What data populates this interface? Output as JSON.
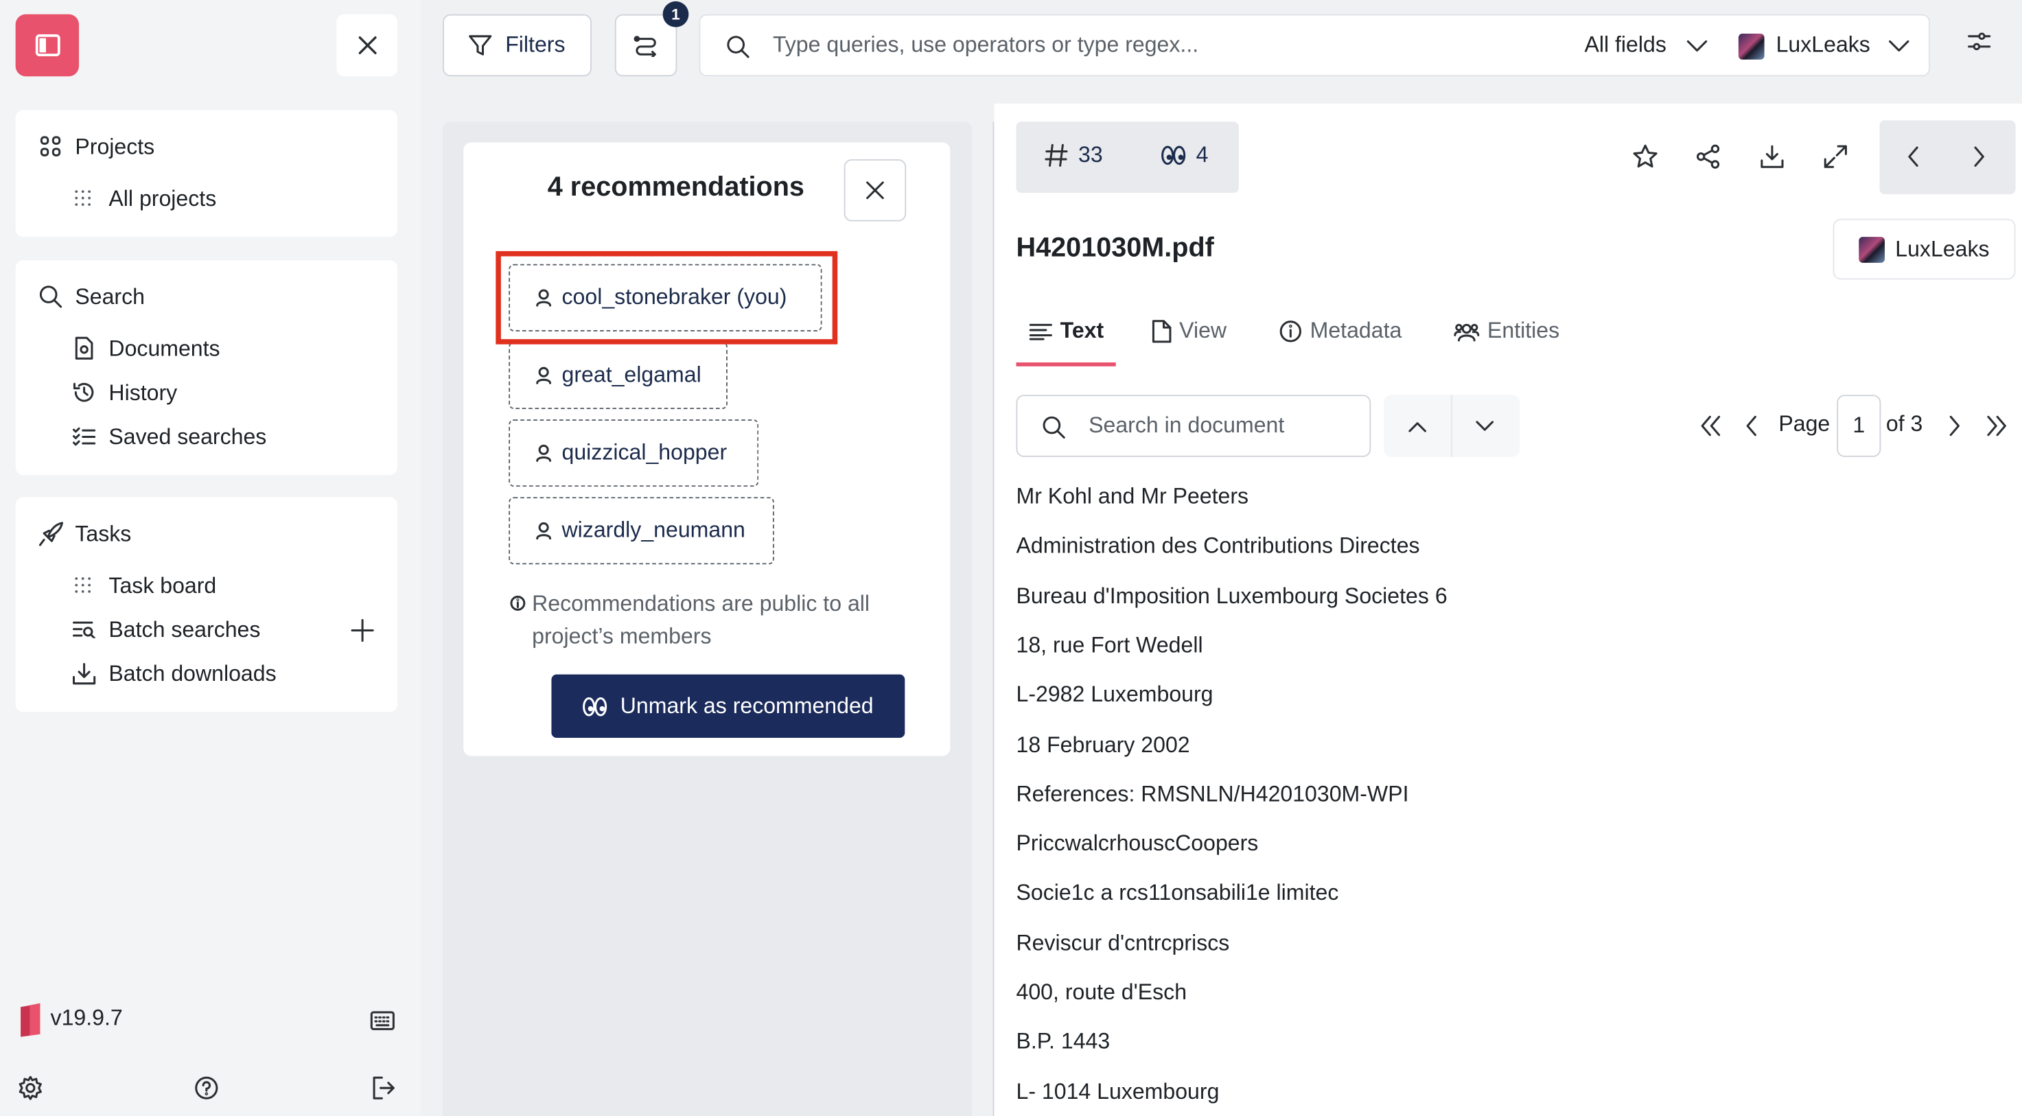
{
  "sidebar": {
    "projects": {
      "title": "Projects",
      "items": [
        "All projects"
      ]
    },
    "search": {
      "title": "Search",
      "items": [
        "Documents",
        "History",
        "Saved searches"
      ]
    },
    "tasks": {
      "title": "Tasks",
      "items": [
        "Task board",
        "Batch searches",
        "Batch downloads"
      ]
    },
    "version": "v19.9.7"
  },
  "topbar": {
    "filters_label": "Filters",
    "history_badge": "1",
    "search_placeholder": "Type queries, use operators or type regex...",
    "fields_select": "All fields",
    "project_select": "LuxLeaks"
  },
  "recommendations": {
    "title": "4 recommendations",
    "users": [
      "cool_stonebraker (you)",
      "great_elgamal",
      "quizzical_hopper",
      "wizardly_neumann"
    ],
    "note": "Recommendations are public to all project’s members",
    "unmark_label": "Unmark as recommended"
  },
  "document": {
    "tag_count": "33",
    "recommended_count": "4",
    "title": "H4201030M.pdf",
    "project": "LuxLeaks",
    "tabs": [
      "Text",
      "View",
      "Metadata",
      "Entities"
    ],
    "active_tab": "Text",
    "search_placeholder": "Search in document",
    "page_label": "Page",
    "page_value": "1",
    "page_of": "of 3",
    "lines": [
      "Mr Kohl and Mr Peeters",
      "Administration des Contributions Directes",
      "Bureau d'Imposition Luxembourg Societes 6",
      "18, rue Fort Wedell",
      "L-2982 Luxembourg",
      "18 February 2002",
      "References: RMSNLN/H4201030M-WPI",
      "PriccwalcrhouscCoopers",
      "Socie1c a rcs11onsabili1e limitec",
      "Reviscur d'cntrcpriscs",
      "400, route d'Esch",
      "B.P. 1443",
      "L- 1014 Luxembourg"
    ]
  },
  "colors": {
    "brand": "#e8526c",
    "navy": "#1b2b5b",
    "highlight": "#e0301e"
  }
}
